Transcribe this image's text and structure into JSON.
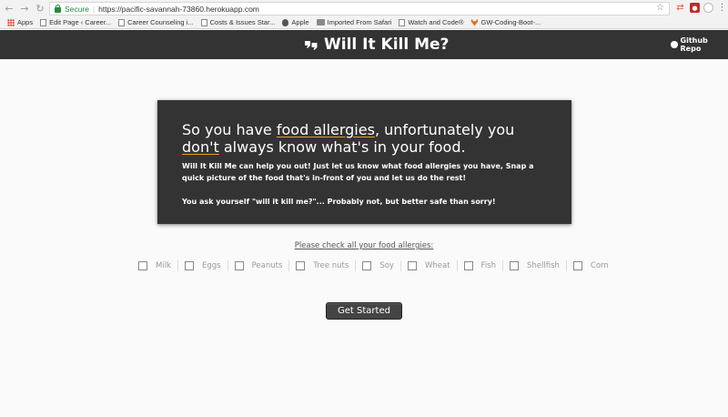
{
  "browser": {
    "secure_label": "Secure",
    "url": "https://pacific-savannah-73860.herokuapp.com",
    "bookmarks": [
      {
        "label": "Apps",
        "icon": "apps-grid-icon"
      },
      {
        "label": "Edit Page ‹ Career...",
        "icon": "page-icon"
      },
      {
        "label": "Career Counseling i...",
        "icon": "page-icon"
      },
      {
        "label": "Costs & Issues Star...",
        "icon": "page-icon"
      },
      {
        "label": "Apple",
        "icon": "apple-icon"
      },
      {
        "label": "Imported From Safari",
        "icon": "folder-icon"
      },
      {
        "label": "Watch and Code®",
        "icon": "page-icon"
      },
      {
        "label": "GW-Coding-Boot-...",
        "icon": "gitlab-icon"
      }
    ]
  },
  "header": {
    "title": "Will It Kill Me?",
    "github_label": "Github Repo",
    "background": "#333333"
  },
  "hero": {
    "heading": {
      "part1": "So you have ",
      "highlight1": "food allergies",
      "part2": ", unfortunately you ",
      "highlight2": "don't",
      "part3": " always know what's in your food."
    },
    "paragraph1": "Will It Kill Me can help you out! Just let us know what food allergies you have, Snap a quick picture of the food that's in-front of you and let us do the rest!",
    "paragraph2": "You ask yourself \"will it kill me?\"... Probably not, but better safe than sorry!"
  },
  "allergies": {
    "prompt": "Please check all your food allergies:",
    "options": [
      "Milk",
      "Eggs",
      "Peanuts",
      "Tree nuts",
      "Soy",
      "Wheat",
      "Fish",
      "Shellfish",
      "Corn"
    ]
  },
  "cta": {
    "label": "Get Started"
  }
}
